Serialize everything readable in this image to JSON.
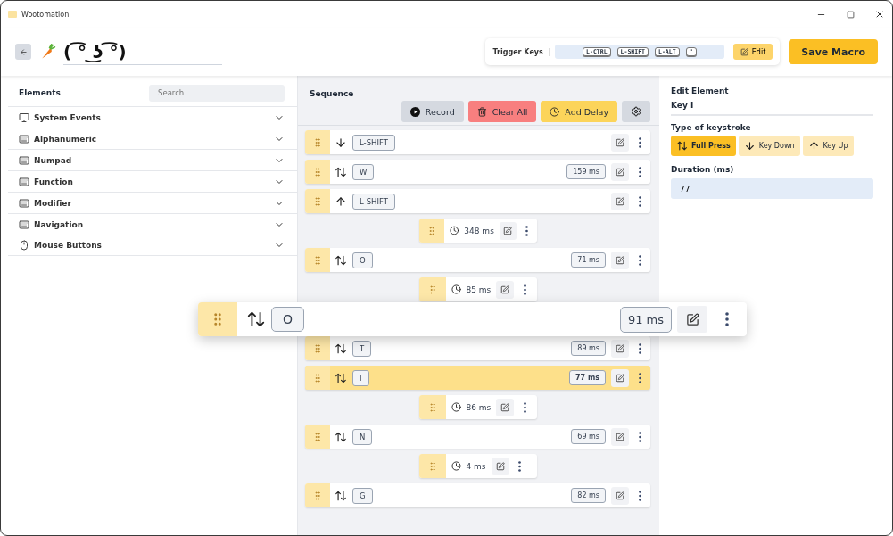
{
  "window": {
    "title": "Wootomation"
  },
  "header": {
    "macro_name": "( ͡° ͜ʖ ͡°)",
    "trigger_label": "Trigger Keys",
    "trigger_keys": [
      "L-CTRL",
      "L-SHIFT",
      "L-ALT",
      "\""
    ],
    "edit_button": "Edit",
    "save_button": "Save Macro"
  },
  "elements": {
    "title": "Elements",
    "search_placeholder": "Search",
    "categories": [
      {
        "label": "System Events",
        "kind": "display",
        "expanded": false
      },
      {
        "label": "Alphanumeric",
        "kind": "keyboard",
        "expanded": false
      },
      {
        "label": "Numpad",
        "kind": "keyboard",
        "expanded": false
      },
      {
        "label": "Function",
        "kind": "keyboard",
        "expanded": false
      },
      {
        "label": "Modifier",
        "kind": "keyboard",
        "expanded": false
      },
      {
        "label": "Navigation",
        "kind": "keyboard",
        "expanded": false
      },
      {
        "label": "Mouse Buttons",
        "kind": "mouse",
        "expanded": false
      }
    ]
  },
  "sequence": {
    "title": "Sequence",
    "record_button": "Record",
    "clear_button": "Clear All",
    "delay_button": "Add Delay",
    "items": [
      {
        "kind": "key_down",
        "key": "L-SHIFT",
        "selected": false,
        "dragging": false
      },
      {
        "kind": "key_full",
        "key": "W",
        "duration": "159 ms",
        "selected": false,
        "dragging": false
      },
      {
        "kind": "key_up",
        "key": "L-SHIFT",
        "selected": false,
        "dragging": false
      },
      {
        "kind": "delay",
        "duration": "348 ms",
        "selected": false,
        "dragging": false
      },
      {
        "kind": "key_full",
        "key": "O",
        "duration": "71 ms",
        "selected": false,
        "dragging": false
      },
      {
        "kind": "delay",
        "duration": "85 ms",
        "selected": false,
        "dragging": false
      },
      {
        "kind": "key_full",
        "key": "O",
        "duration": "91 ms",
        "selected": false,
        "dragging": true
      },
      {
        "kind": "key_full",
        "key": "T",
        "duration": "89 ms",
        "selected": false,
        "dragging": false
      },
      {
        "kind": "key_full",
        "key": "I",
        "duration": "77 ms",
        "selected": true,
        "dragging": false
      },
      {
        "kind": "delay",
        "duration": "86 ms",
        "selected": false,
        "dragging": false
      },
      {
        "kind": "key_full",
        "key": "N",
        "duration": "69 ms",
        "selected": false,
        "dragging": false
      },
      {
        "kind": "delay",
        "duration": "4 ms",
        "selected": false,
        "dragging": false
      },
      {
        "kind": "key_full",
        "key": "G",
        "duration": "82 ms",
        "selected": false,
        "dragging": false
      }
    ]
  },
  "editor": {
    "title": "Edit Element",
    "element_name": "Key I",
    "type_label": "Type of keystroke",
    "types": [
      {
        "label": "Full Press",
        "kind": "full",
        "selected": true
      },
      {
        "label": "Key Down",
        "kind": "down",
        "selected": false
      },
      {
        "label": "Key Up",
        "kind": "up",
        "selected": false
      }
    ],
    "duration_label": "Duration (ms)",
    "duration_value": "77"
  }
}
